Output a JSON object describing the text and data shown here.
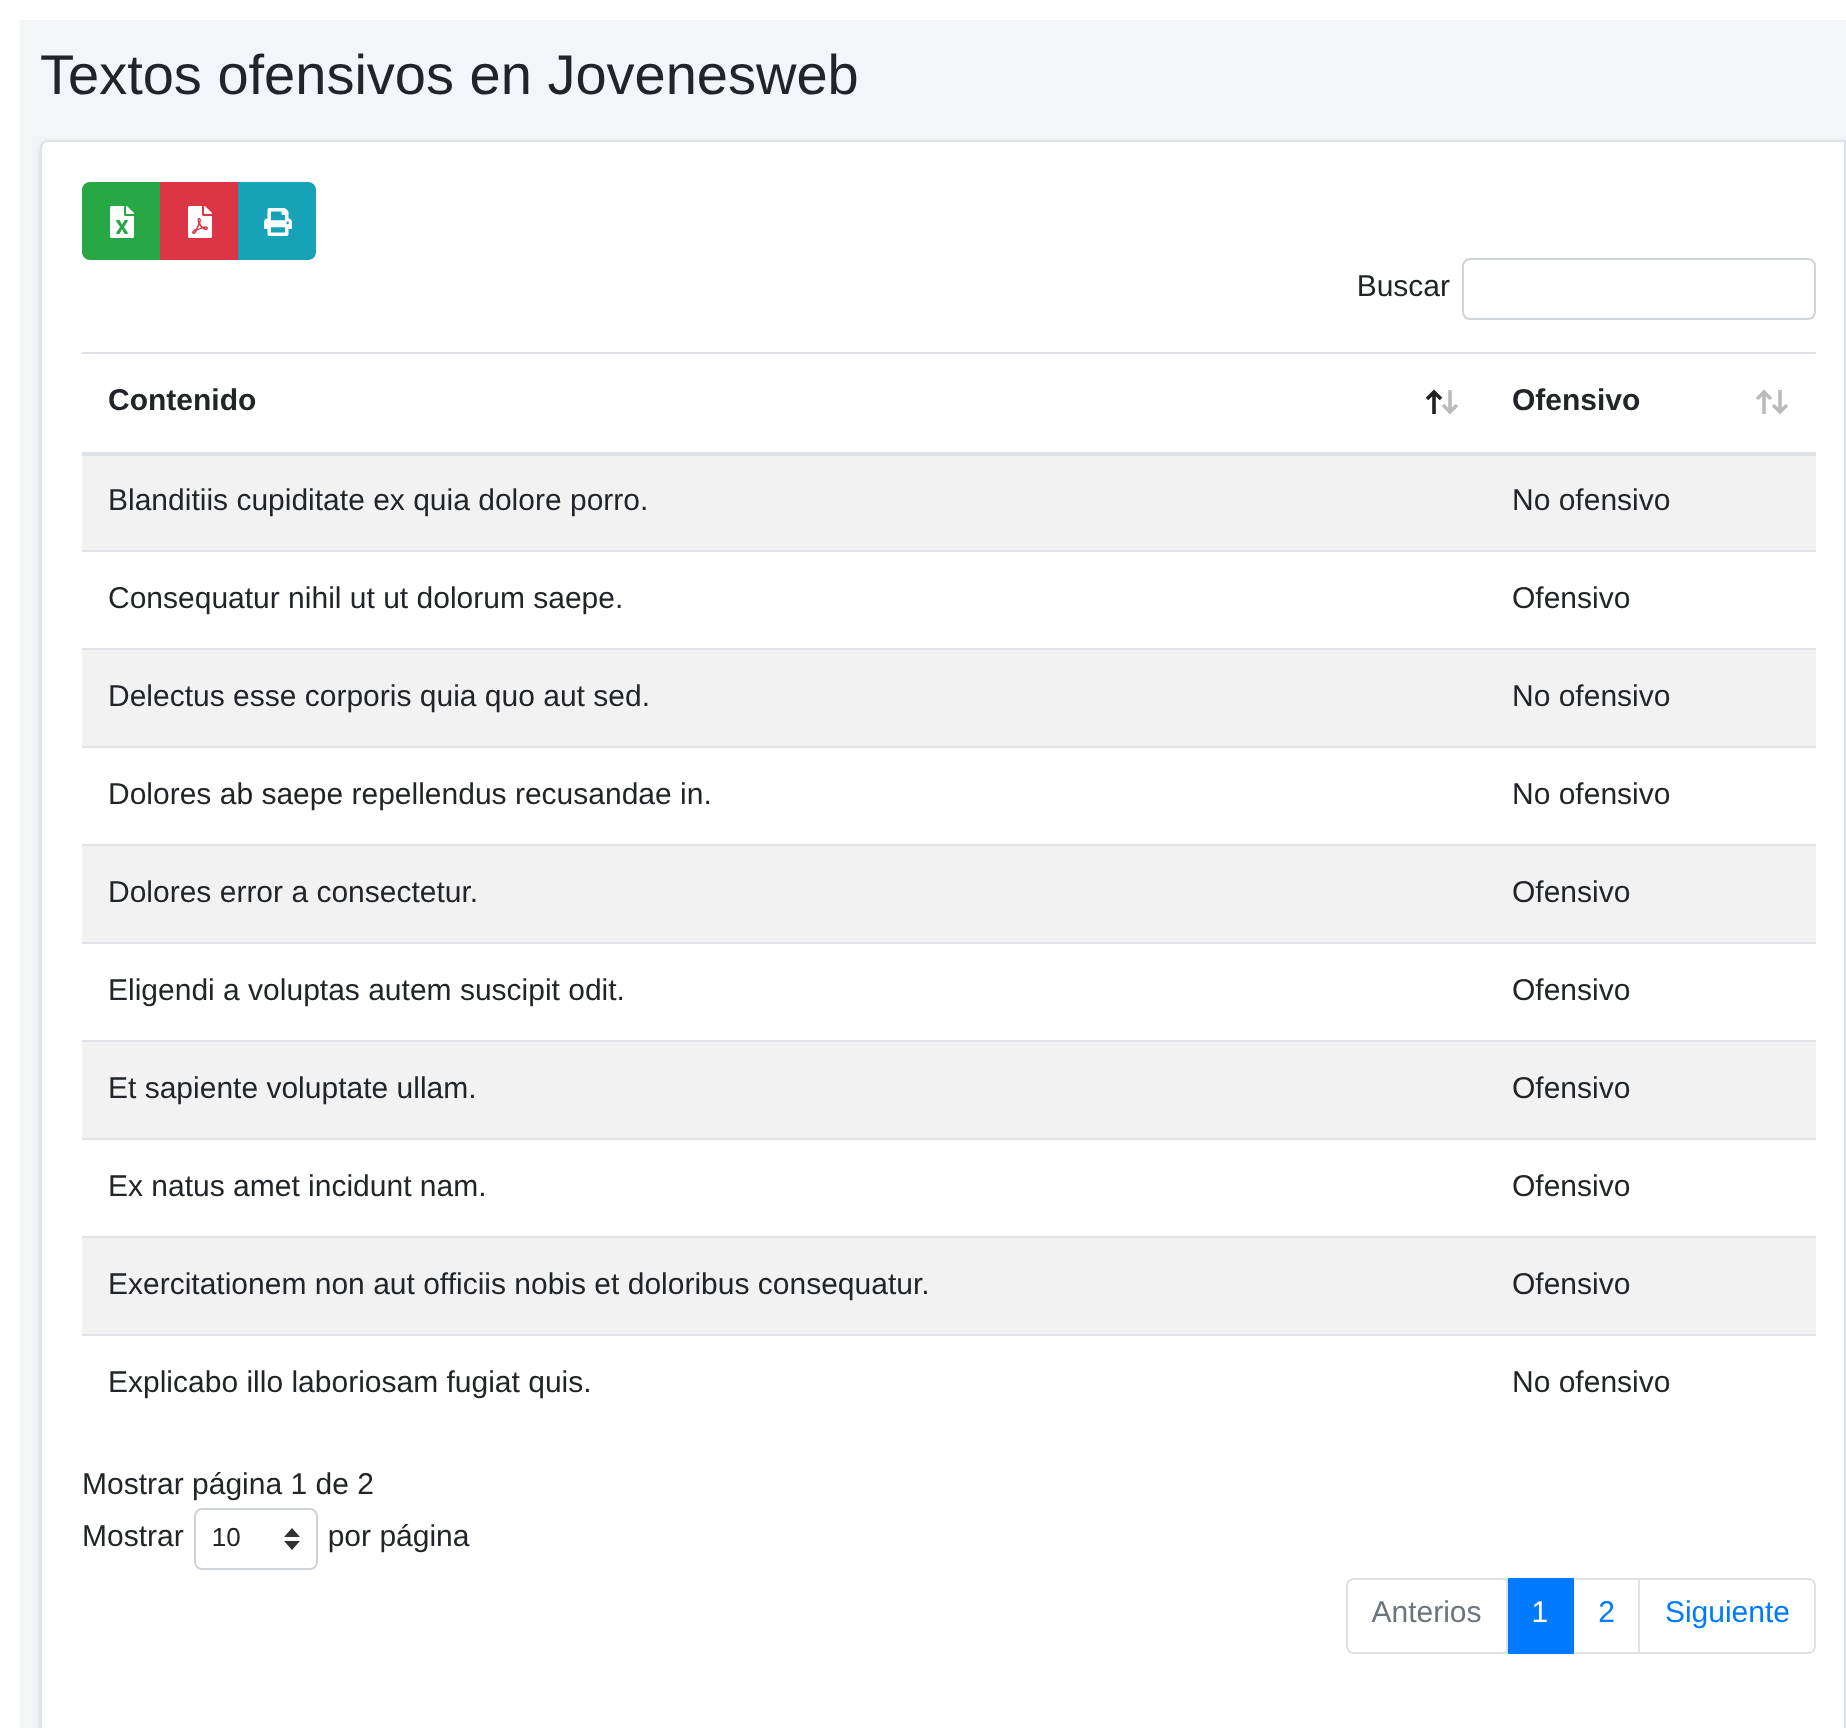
{
  "title": "Textos ofensivos en Jovenesweb",
  "export_buttons": [
    {
      "kind": "excel"
    },
    {
      "kind": "pdf"
    },
    {
      "kind": "print"
    }
  ],
  "search": {
    "label": "Buscar"
  },
  "table": {
    "columns": [
      {
        "label": "Contenido",
        "sorted_ascending": true
      },
      {
        "label": "Ofensivo",
        "sorted_ascending": false
      }
    ],
    "rows": [
      [
        "Blanditiis cupiditate ex quia dolore porro.",
        "No ofensivo"
      ],
      [
        "Consequatur nihil ut ut dolorum saepe.",
        "Ofensivo"
      ],
      [
        "Delectus esse corporis quia quo aut sed.",
        "No ofensivo"
      ],
      [
        "Dolores ab saepe repellendus recusandae in.",
        "No ofensivo"
      ],
      [
        "Dolores error a consectetur.",
        "Ofensivo"
      ],
      [
        "Eligendi a voluptas autem suscipit odit.",
        "Ofensivo"
      ],
      [
        "Et sapiente voluptate ullam.",
        "Ofensivo"
      ],
      [
        "Ex natus amet incidunt nam.",
        "Ofensivo"
      ],
      [
        "Exercitationem non aut officiis nobis et doloribus consequatur.",
        "Ofensivo"
      ],
      [
        "Explicabo illo laboriosam fugiat quis.",
        "No ofensivo"
      ]
    ]
  },
  "page_info": "Mostrar página 1 de 2",
  "page_size": {
    "before": "Mostrar",
    "value": "10",
    "after": "por página"
  },
  "pagination": [
    {
      "label": "Anterios",
      "selected": false,
      "disabled": true
    },
    {
      "label": "1",
      "selected": true,
      "disabled": false
    },
    {
      "label": "2",
      "selected": false,
      "disabled": false
    },
    {
      "label": "Siguiente",
      "selected": false,
      "disabled": false
    }
  ]
}
